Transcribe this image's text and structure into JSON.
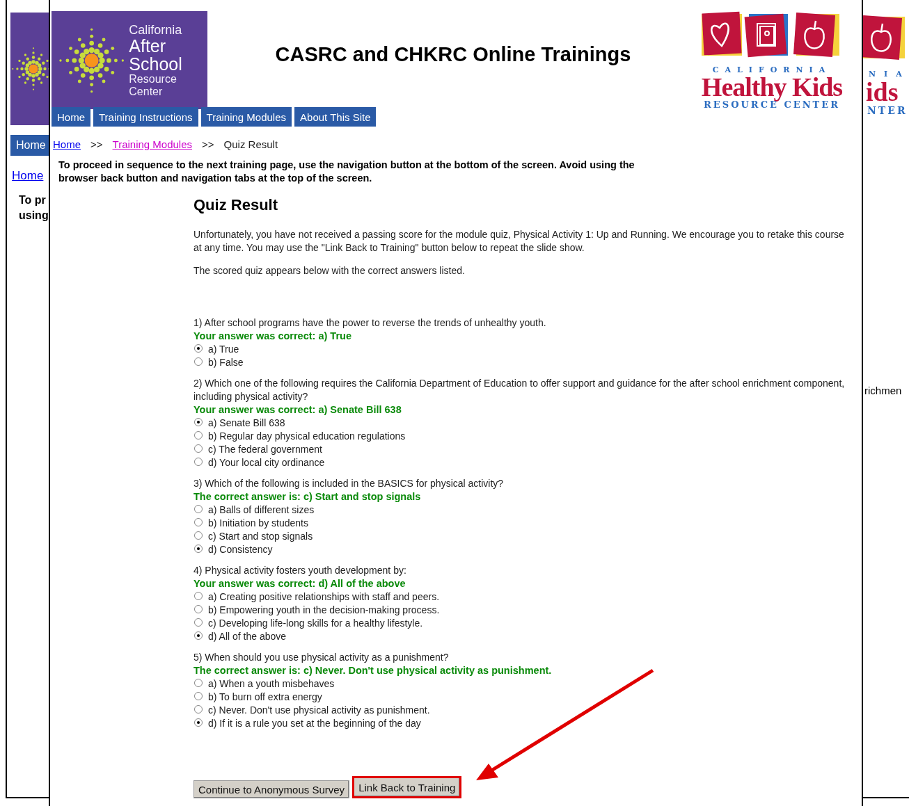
{
  "background_left": {
    "nav_button": "Home",
    "link": "Home",
    "notice_lines": [
      "To pr",
      "using"
    ]
  },
  "background_right": {
    "logo_letters": "NIA",
    "logo_word": "ids",
    "logo_bottom": "NTER",
    "text": "richmen"
  },
  "header": {
    "logo_left": {
      "line1": "California",
      "line2": "After School",
      "line3": "Resource Center"
    },
    "title": "CASRC and CHKRC Online Trainings",
    "logo_right": {
      "line1": "CALIFORNIA",
      "line2": "Healthy Kids",
      "line3": "RESOURCE CENTER"
    }
  },
  "nav": [
    "Home",
    "Training Instructions",
    "Training Modules",
    "About This Site"
  ],
  "breadcrumb": [
    {
      "label": "Home",
      "kind": "link",
      "visited": false
    },
    {
      "label": ">>",
      "kind": "separator"
    },
    {
      "label": "Training Modules",
      "kind": "link",
      "visited": true
    },
    {
      "label": ">>",
      "kind": "separator"
    },
    {
      "label": "Quiz Result",
      "kind": "current"
    }
  ],
  "notice": "To proceed in sequence to the next training page, use the navigation button at the bottom of the screen. Avoid using the browser back button and navigation tabs at the top of the screen.",
  "heading": "Quiz Result",
  "paragraphs": [
    "Unfortunately, you have not received a passing score for the module quiz, Physical Activity 1: Up and Running. We encourage you to retake this course at any time. You may use the \"Link Back to Training\" button below to repeat the slide show.",
    "The scored quiz appears below with the correct answers listed."
  ],
  "questions": [
    {
      "text": "1) After school programs have the power to reverse the trends of unhealthy youth.",
      "result": "Your answer was correct: a) True",
      "options": [
        {
          "label": "a) True",
          "selected": true
        },
        {
          "label": "b) False",
          "selected": false
        }
      ]
    },
    {
      "text": "2) Which one of the following requires the California Department of Education to offer support and guidance for the after school enrichment component, including physical activity?",
      "result": "Your answer was correct: a) Senate Bill 638",
      "options": [
        {
          "label": "a) Senate Bill 638",
          "selected": true
        },
        {
          "label": "b) Regular day physical education regulations",
          "selected": false
        },
        {
          "label": "c) The federal government",
          "selected": false
        },
        {
          "label": "d) Your local city ordinance",
          "selected": false
        }
      ]
    },
    {
      "text": "3) Which of the following is included in the BASICS for physical activity?",
      "result": "The correct answer is: c) Start and stop signals",
      "options": [
        {
          "label": "a) Balls of different sizes",
          "selected": false
        },
        {
          "label": "b) Initiation by students",
          "selected": false
        },
        {
          "label": "c) Start and stop signals",
          "selected": false
        },
        {
          "label": "d) Consistency",
          "selected": true
        }
      ]
    },
    {
      "text": "4) Physical activity fosters youth development by:",
      "result": "Your answer was correct: d) All of the above",
      "options": [
        {
          "label": "a) Creating positive relationships with staff and peers.",
          "selected": false
        },
        {
          "label": "b) Empowering youth in the decision-making process.",
          "selected": false
        },
        {
          "label": "c) Developing life-long skills for a healthy lifestyle.",
          "selected": false
        },
        {
          "label": "d) All of the above",
          "selected": true
        }
      ]
    },
    {
      "text": "5) When should you use physical activity as a punishment?",
      "result": "The correct answer is: c) Never. Don't use physical activity as punishment.",
      "options": [
        {
          "label": "a) When a youth misbehaves",
          "selected": false
        },
        {
          "label": "b) To burn off extra energy",
          "selected": false
        },
        {
          "label": "c) Never. Don't use physical activity as punishment.",
          "selected": false
        },
        {
          "label": "d) If it is a rule you set at the beginning of the day",
          "selected": true
        }
      ]
    }
  ],
  "buttons": [
    {
      "label": "Continue to Anonymous Survey",
      "highlighted": false
    },
    {
      "label": "Link Back to Training",
      "highlighted": true
    }
  ]
}
